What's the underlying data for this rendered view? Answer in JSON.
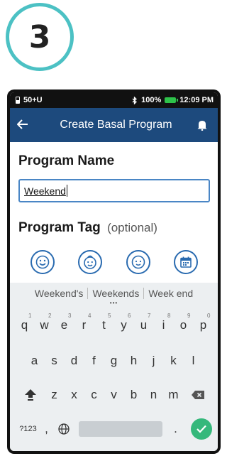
{
  "step": {
    "number": "3"
  },
  "status_bar": {
    "left_text": "50+U",
    "battery_percent": "100%",
    "time": "12:09 PM"
  },
  "app_bar": {
    "title": "Create Basal Program",
    "back_icon": "arrow-left-icon",
    "bell_icon": "bell-icon"
  },
  "form": {
    "program_name_label": "Program Name",
    "program_name_value": "Weekend",
    "program_tag_label": "Program Tag",
    "program_tag_optional": "(optional)",
    "tags": [
      {
        "icon": "smiley-face-icon"
      },
      {
        "icon": "baby-face-icon"
      },
      {
        "icon": "child-face-icon"
      },
      {
        "icon": "calendar-icon"
      }
    ]
  },
  "keyboard": {
    "suggestions": [
      "Weekend's",
      "Weekends",
      "Week end"
    ],
    "row1": [
      {
        "k": "q",
        "n": "1"
      },
      {
        "k": "w",
        "n": "2"
      },
      {
        "k": "e",
        "n": "3"
      },
      {
        "k": "r",
        "n": "4"
      },
      {
        "k": "t",
        "n": "5"
      },
      {
        "k": "y",
        "n": "6"
      },
      {
        "k": "u",
        "n": "7"
      },
      {
        "k": "i",
        "n": "8"
      },
      {
        "k": "o",
        "n": "9"
      },
      {
        "k": "p",
        "n": "0"
      }
    ],
    "row2": [
      "a",
      "s",
      "d",
      "f",
      "g",
      "h",
      "j",
      "k",
      "l"
    ],
    "row3": [
      "z",
      "x",
      "c",
      "v",
      "b",
      "n",
      "m"
    ],
    "symbols_label": "?123",
    "comma": ",",
    "period": ".",
    "accent_color": "#35b87b"
  },
  "colors": {
    "app_bar": "#1d4a7d",
    "step_ring": "#4cc1c4",
    "input_border": "#4a86c5"
  }
}
